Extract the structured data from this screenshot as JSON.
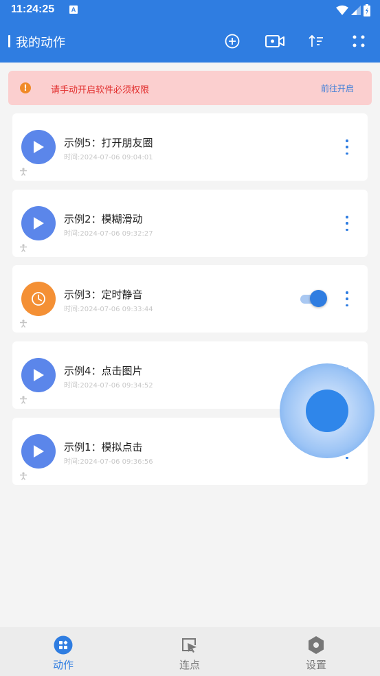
{
  "status_bar": {
    "time": "11:24:25",
    "a_badge": "A"
  },
  "toolbar": {
    "title": "我的动作",
    "actions": [
      "add-circle-icon",
      "video-camera-icon",
      "sort-icon",
      "grid-dots-icon"
    ]
  },
  "alert": {
    "icon": "!",
    "message": "请手动开启软件必须权限",
    "link": "前往开启"
  },
  "actions_list": [
    {
      "title": "示例5：打开朋友圈",
      "time": "时间:2024-07-06 09:04:01",
      "icon": "play-icon",
      "color": "#5b86ea",
      "toggle": null
    },
    {
      "title": "示例2：模糊滑动",
      "time": "时间:2024-07-06 09:32:27",
      "icon": "play-icon",
      "color": "#5b86ea",
      "toggle": null
    },
    {
      "title": "示例3：定时静音",
      "time": "时间:2024-07-06 09:33:44",
      "icon": "clock-icon",
      "color": "#f49035",
      "toggle": true
    },
    {
      "title": "示例4：点击图片",
      "time": "时间:2024-07-06 09:34:52",
      "icon": "play-icon",
      "color": "#5b86ea",
      "toggle": null
    },
    {
      "title": "示例1：模拟点击",
      "time": "时间:2024-07-06 09:36:56",
      "icon": "play-icon",
      "color": "#5b86ea",
      "toggle": null
    }
  ],
  "bottom_nav": [
    {
      "label": "动作",
      "icon": "actions-grid-icon",
      "active": true
    },
    {
      "label": "连点",
      "icon": "cursor-click-icon",
      "active": false
    },
    {
      "label": "设置",
      "icon": "settings-hex-icon",
      "active": false
    }
  ],
  "colors": {
    "primary": "#2f7de1",
    "alert_bg": "#fbcfcf",
    "alert_text": "#e2302f",
    "orange": "#f49035"
  }
}
